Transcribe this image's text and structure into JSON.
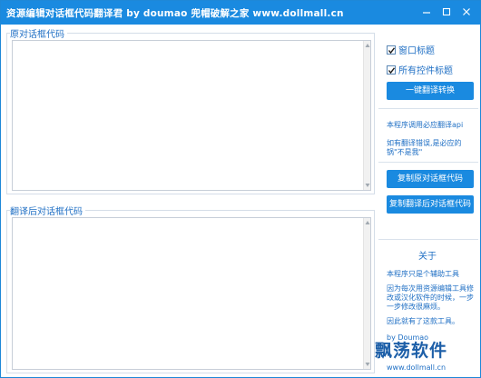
{
  "window": {
    "title": "资源编辑对话框代码翻译君 by doumao 兜帽破解之家 www.dollmall.cn",
    "controls": {
      "minimize": "—",
      "maximize": "□",
      "close": "✕"
    }
  },
  "source_panel": {
    "label": "原对话框代码",
    "value": ""
  },
  "translated_panel": {
    "label": "翻译后对话框代码",
    "value": ""
  },
  "options": {
    "title_checkbox": {
      "label": "窗口标题",
      "checked": true
    },
    "all_controls_checkbox": {
      "label": "所有控件标题",
      "checked": true
    }
  },
  "buttons": {
    "translate": "一键翻译转换",
    "copy_source": "复制原对话框代码",
    "copy_translated": "复制翻译后对话框代码"
  },
  "notes": {
    "api_note": "本程序调用必应翻译api",
    "error_note": "如有翻译错误,是必应的锅\"不是我\""
  },
  "about": {
    "title": "关于",
    "line1": "本程序只是个辅助工具",
    "line2": "因为每次用资源编辑工具修改或汉化软件的时候，一步一步修改很麻烦。",
    "line3": "因此就有了这款工具。",
    "author": "by Doumao",
    "watermark": "飘荡软件",
    "site": "www.dollmall.cn"
  },
  "colors": {
    "accent": "#1a8ae0",
    "text": "#1f6fc4",
    "border": "#1e88d8"
  }
}
